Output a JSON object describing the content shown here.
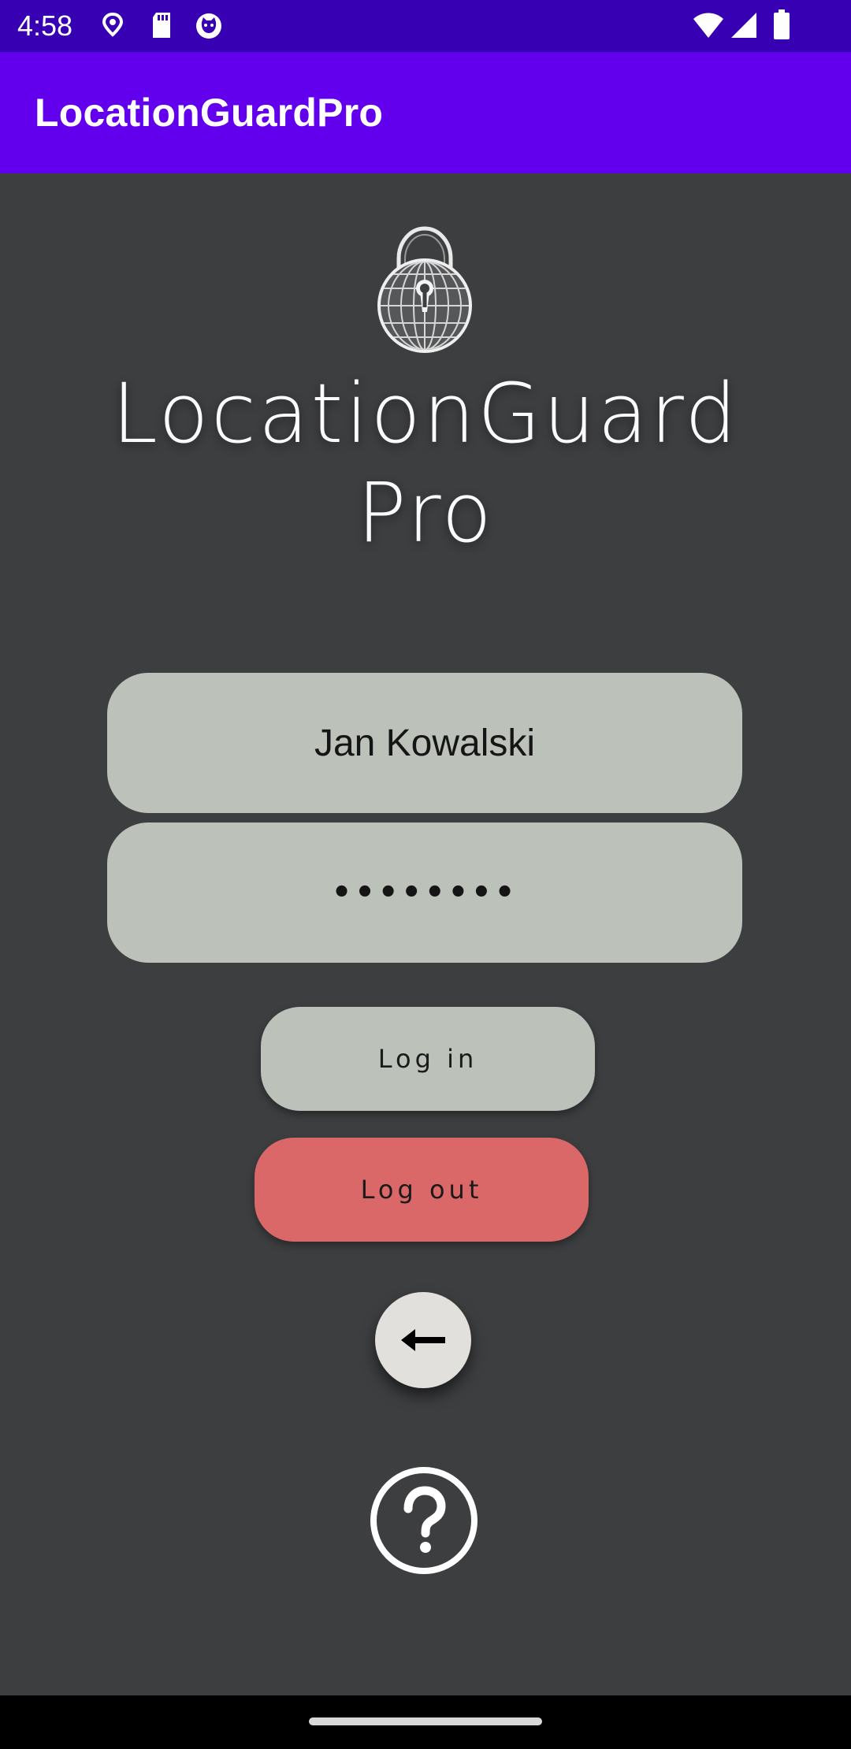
{
  "status_bar": {
    "time": "4:58",
    "icons": [
      "location-pin-icon",
      "sd-card-icon",
      "cat-face-icon",
      "wifi-icon",
      "cellular-signal-icon",
      "battery-icon"
    ]
  },
  "app_bar": {
    "title": "LocationGuardPro"
  },
  "logo": {
    "icon": "lock-globe-icon"
  },
  "brand": {
    "line1": "LocationGuard",
    "line2": "Pro"
  },
  "form": {
    "username_value": "Jan Kowalski",
    "password_value": "••••••••"
  },
  "buttons": {
    "login_label": "Log in",
    "logout_label": "Log out",
    "back_icon": "arrow-left-icon",
    "help_icon": "help-circle-icon"
  },
  "colors": {
    "status_bar": "#3700b3",
    "app_bar": "#6200ee",
    "background": "#3d3e40",
    "field": "#bcc1ba",
    "logout": "#db6868",
    "fab": "#e1e0dc"
  }
}
